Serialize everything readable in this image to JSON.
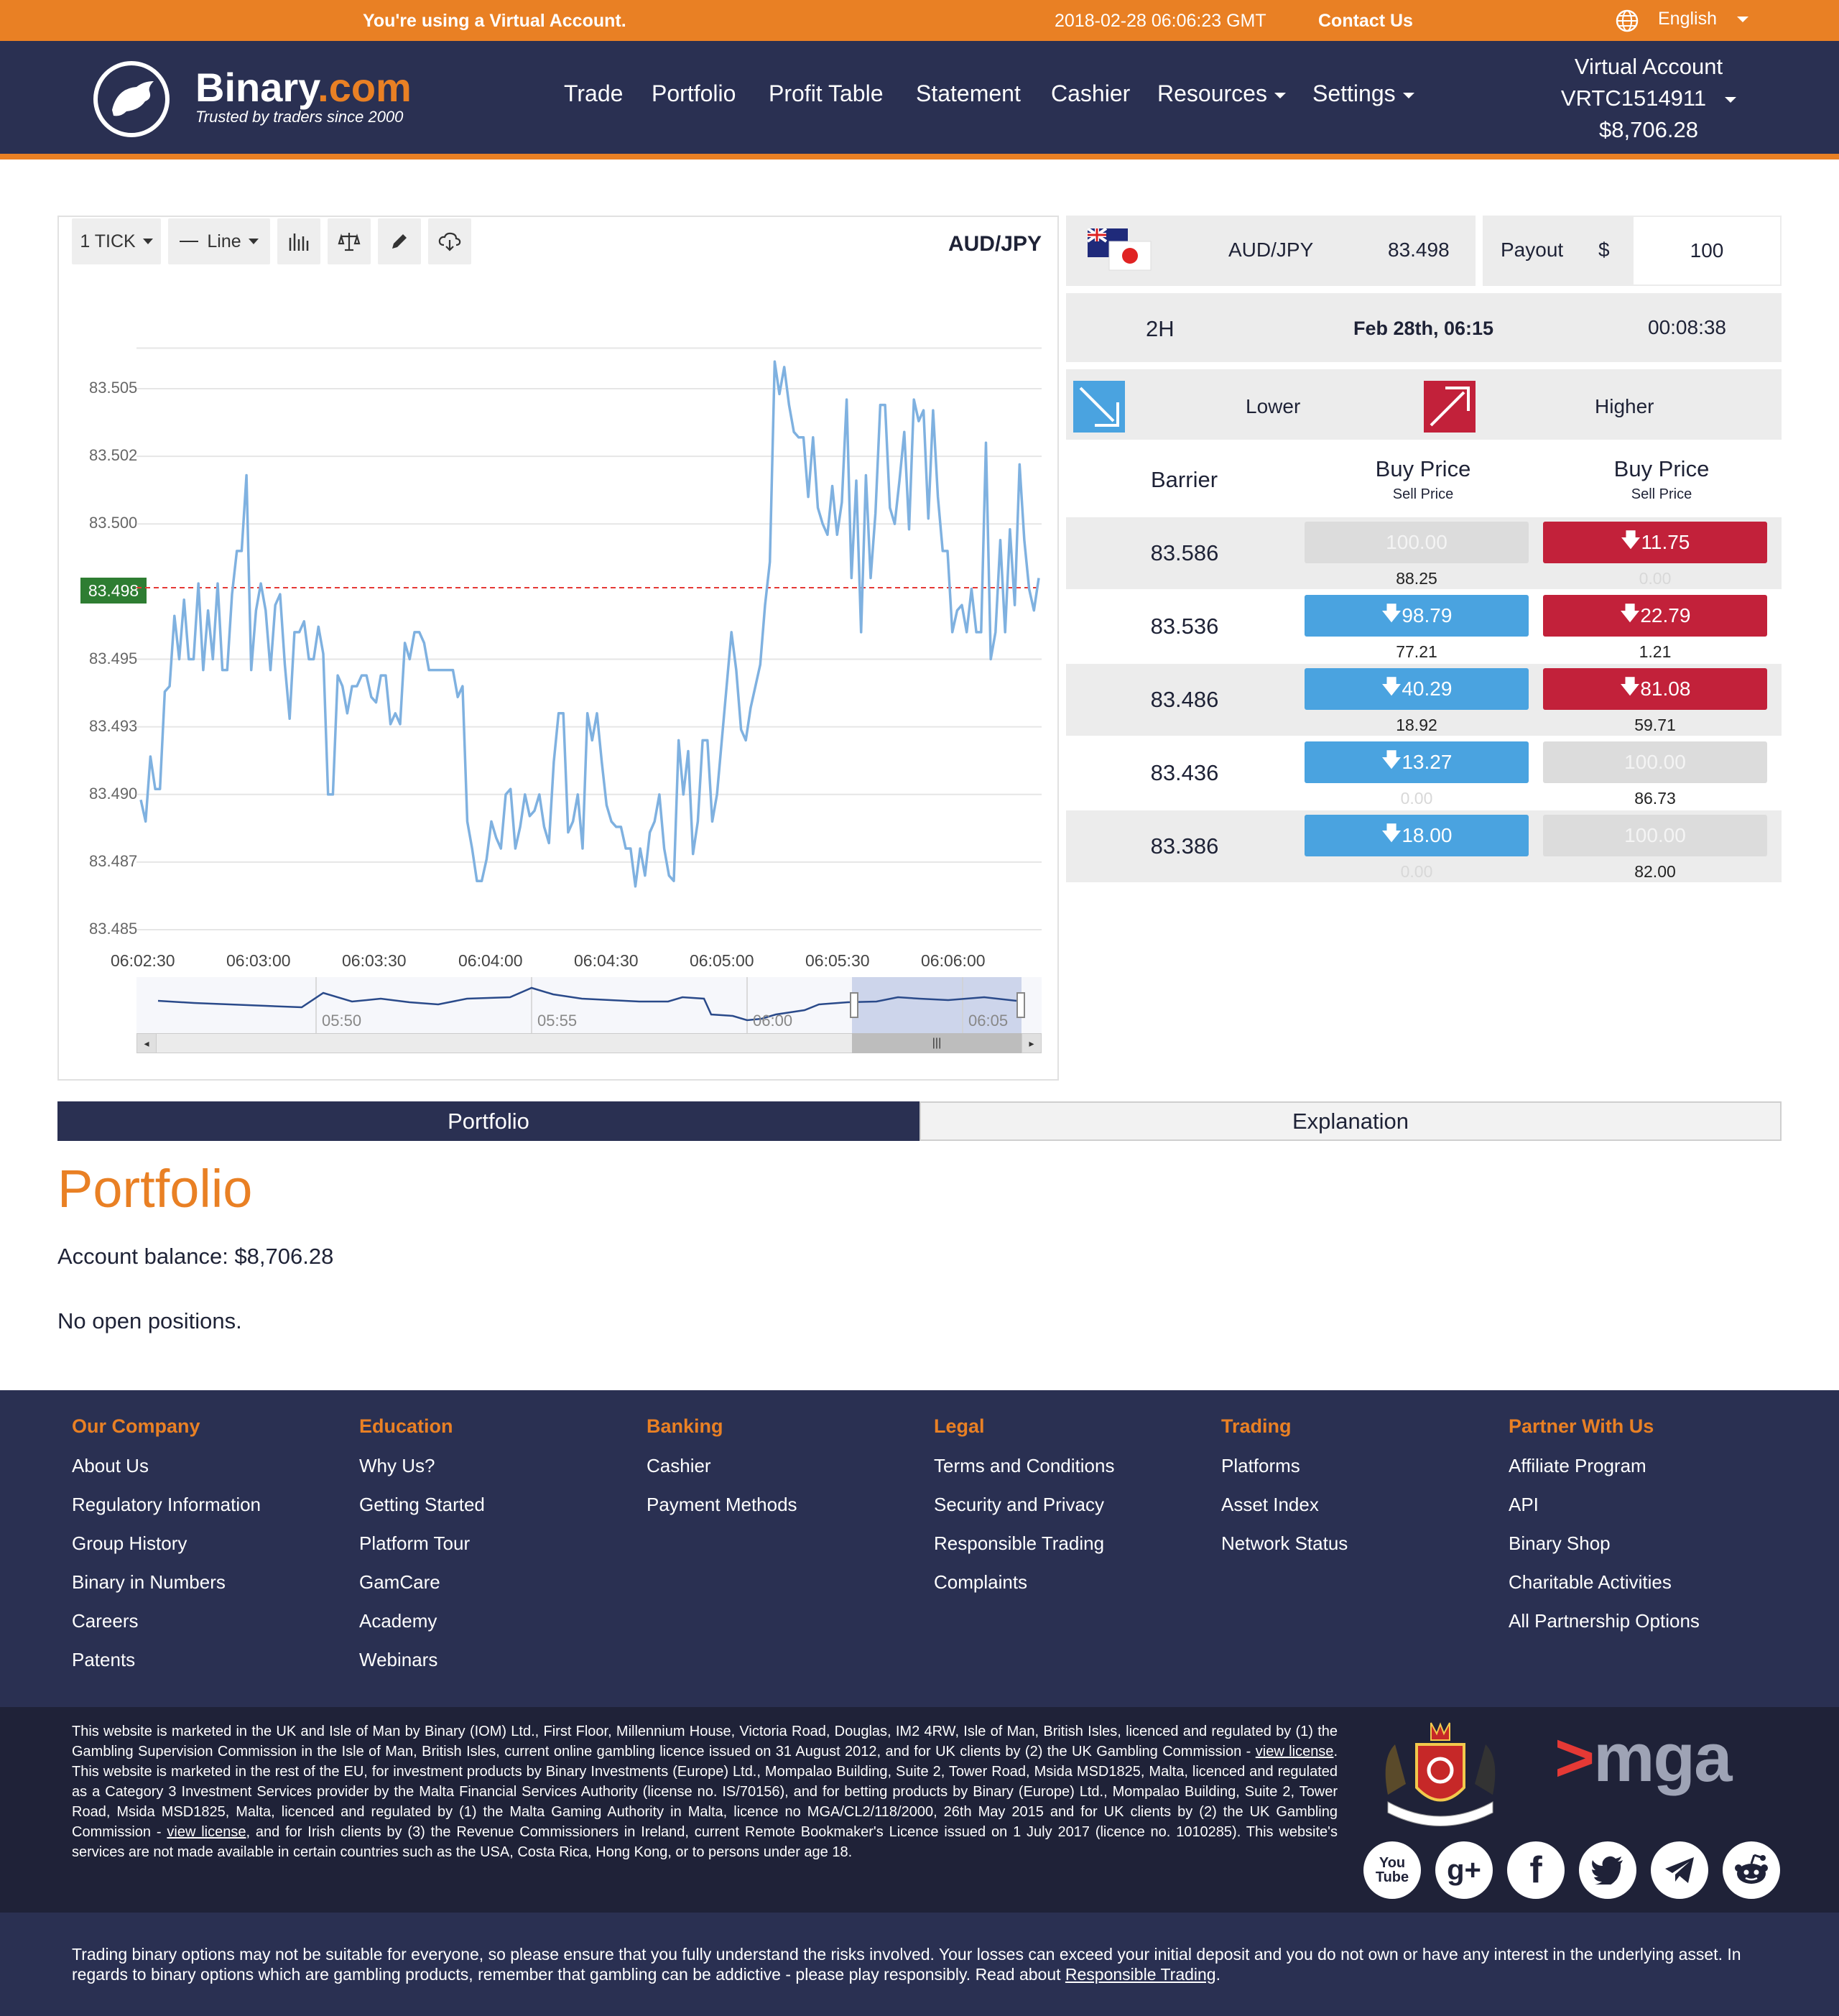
{
  "topbar": {
    "virtual_notice": "You're using a Virtual Account.",
    "timestamp": "2018-02-28 06:06:23 GMT",
    "contact": "Contact Us",
    "language": "English"
  },
  "header": {
    "brand_main": "Binary",
    "brand_tld": ".com",
    "tagline": "Trusted by traders since 2000",
    "nav": [
      "Trade",
      "Portfolio",
      "Profit Table",
      "Statement",
      "Cashier",
      "Resources",
      "Settings"
    ],
    "account_type": "Virtual Account",
    "account_id": "VRTC1514911",
    "balance": "$8,706.28"
  },
  "chart": {
    "interval": "1 TICK",
    "chart_type": "Line",
    "symbol": "AUD/JPY",
    "current_price_label": "83.498",
    "nav_labels": [
      "05:50",
      "05:55",
      "06:00",
      "06:05"
    ]
  },
  "chart_data": {
    "type": "line",
    "title": "AUD/JPY",
    "xlabel": "",
    "ylabel": "",
    "x_ticks": [
      "06:02:30",
      "06:03:00",
      "06:03:30",
      "06:04:00",
      "06:04:30",
      "06:05:00",
      "06:05:30",
      "06:06:00"
    ],
    "y_ticks": [
      "83.485",
      "83.487",
      "83.490",
      "83.493",
      "83.495",
      "83.498",
      "83.500",
      "83.502",
      "83.505"
    ],
    "ylim": [
      83.485,
      83.507
    ],
    "current_price": 83.498,
    "series": [
      {
        "values": [
          83.4898,
          83.489,
          83.4914,
          83.4902,
          83.4902,
          83.4938,
          83.494,
          83.4966,
          83.495,
          83.4972,
          83.495,
          83.495,
          83.4978,
          83.4946,
          83.4968,
          83.495,
          83.4978,
          83.4946,
          83.4946,
          83.4974,
          83.499,
          83.499,
          83.5018,
          83.4946,
          83.4968,
          83.4978,
          83.4968,
          83.4946,
          83.497,
          83.4974,
          83.4948,
          83.4928,
          83.496,
          83.496,
          83.4964,
          83.495,
          83.495,
          83.4962,
          83.4952,
          83.49,
          83.49,
          83.4944,
          83.494,
          83.493,
          83.494,
          83.494,
          83.4944,
          83.4944,
          83.4936,
          83.4934,
          83.4944,
          83.4944,
          83.4926,
          83.493,
          83.4926,
          83.4956,
          83.495,
          83.496,
          83.496,
          83.4956,
          83.4946,
          83.4946,
          83.4946,
          83.4946,
          83.4946,
          83.4946,
          83.4936,
          83.494,
          83.489,
          83.488,
          83.4868,
          83.4868,
          83.4876,
          83.489,
          83.4884,
          83.488,
          83.49,
          83.4902,
          83.488,
          83.4888,
          83.49,
          83.4892,
          83.4894,
          83.49,
          83.4888,
          83.4882,
          83.4912,
          83.493,
          83.493,
          83.4886,
          83.489,
          83.49,
          83.488,
          83.493,
          83.492,
          83.493,
          83.4912,
          83.4896,
          83.489,
          83.4888,
          83.4888,
          83.488,
          83.488,
          83.4866,
          83.488,
          83.487,
          83.4886,
          83.489,
          83.49,
          83.488,
          83.487,
          83.4868,
          83.492,
          83.49,
          83.4916,
          83.4878,
          83.489,
          83.492,
          83.492,
          83.489,
          83.49,
          83.492,
          83.494,
          83.496,
          83.4946,
          83.4924,
          83.492,
          83.4932,
          83.494,
          83.4948,
          83.497,
          83.4986,
          83.506,
          83.5048,
          83.5058,
          83.5044,
          83.5034,
          83.5032,
          83.5032,
          83.501,
          83.5032,
          83.5006,
          83.5,
          83.4996,
          83.5014,
          83.4996,
          83.5008,
          83.5046,
          83.498,
          83.5016,
          83.496,
          83.5018,
          83.498,
          83.5004,
          83.5044,
          83.5044,
          83.5006,
          83.5,
          83.5016,
          83.5034,
          83.4998,
          83.5046,
          83.5038,
          83.5042,
          83.5002,
          83.5042,
          83.501,
          83.499,
          83.499,
          83.496,
          83.4968,
          83.497,
          83.496,
          83.4976,
          83.496,
          83.496,
          83.503,
          83.495,
          83.496,
          83.4994,
          83.496,
          83.4998,
          83.497,
          83.5022,
          83.4994,
          83.4976,
          83.4968,
          83.498
        ]
      }
    ]
  },
  "trade": {
    "symbol": "AUD/JPY",
    "spot": "83.498",
    "payout_label": "Payout",
    "currency": "$",
    "payout_value": "100",
    "duration": "2H",
    "expiry": "Feb 28th, 06:15",
    "countdown": "00:08:38",
    "lower_label": "Lower",
    "higher_label": "Higher",
    "barrier_header": "Barrier",
    "buy_price": "Buy Price",
    "sell_price": "Sell Price",
    "rows": [
      {
        "barrier": "83.586",
        "lower_buy": "100.00",
        "lower_sell": "88.25",
        "higher_buy": "11.75",
        "higher_sell": "0.00"
      },
      {
        "barrier": "83.536",
        "lower_buy": "98.79",
        "lower_sell": "77.21",
        "higher_buy": "22.79",
        "higher_sell": "1.21"
      },
      {
        "barrier": "83.486",
        "lower_buy": "40.29",
        "lower_sell": "18.92",
        "higher_buy": "81.08",
        "higher_sell": "59.71"
      },
      {
        "barrier": "83.436",
        "lower_buy": "13.27",
        "lower_sell": "0.00",
        "higher_buy": "100.00",
        "higher_sell": "86.73"
      },
      {
        "barrier": "83.386",
        "lower_buy": "18.00",
        "lower_sell": "0.00",
        "higher_buy": "100.00",
        "higher_sell": "82.00"
      }
    ]
  },
  "tabs": {
    "portfolio": "Portfolio",
    "explanation": "Explanation"
  },
  "portfolio": {
    "title": "Portfolio",
    "balance_text": "Account balance: $8,706.28",
    "empty_text": "No open positions."
  },
  "footer": {
    "columns": [
      {
        "title": "Our Company",
        "links": [
          "About Us",
          "Regulatory Information",
          "Group History",
          "Binary in Numbers",
          "Careers",
          "Patents"
        ]
      },
      {
        "title": "Education",
        "links": [
          "Why Us?",
          "Getting Started",
          "Platform Tour",
          "GamCare",
          "Academy",
          "Webinars"
        ]
      },
      {
        "title": "Banking",
        "links": [
          "Cashier",
          "Payment Methods"
        ]
      },
      {
        "title": "Legal",
        "links": [
          "Terms and Conditions",
          "Security and Privacy",
          "Responsible Trading",
          "Complaints"
        ]
      },
      {
        "title": "Trading",
        "links": [
          "Platforms",
          "Asset Index",
          "Network Status"
        ]
      },
      {
        "title": "Partner With Us",
        "links": [
          "Affiliate Program",
          "API",
          "Binary Shop",
          "Charitable Activities",
          "All Partnership Options"
        ]
      }
    ],
    "legal_1": "This website is marketed in the UK and Isle of Man by Binary (IOM) Ltd., First Floor, Millennium House, Victoria Road, Douglas, IM2 4RW, Isle of Man, British Isles, licenced and regulated by (1) the Gambling Supervision Commission in the Isle of Man, British Isles, current online gambling licence issued on 31 August 2012, and for UK clients by (2) the UK Gambling Commission - ",
    "view_license": "view license",
    "legal_2": ". This website is marketed in the rest of the EU, for investment products by Binary Investments (Europe) Ltd., Mompalao Building, Suite 2, Tower Road, Msida MSD1825, Malta, licenced and regulated as a Category 3 Investment Services provider by the Malta Financial Services Authority (license no. IS/70156), and for betting products by Binary (Europe) Ltd., Mompalao Building, Suite 2, Tower Road, Msida MSD1825, Malta, licenced and regulated by (1) the Malta Gaming Authority in Malta, licence no MGA/CL2/118/2000, 26th May 2015 and for UK clients by (2) the UK Gambling Commission - ",
    "legal_3": ", and for Irish clients by (3) the Revenue Commissioners in Ireland, current Remote Bookmaker's Licence issued on 1 July 2017 (licence no. 1010285). This website's services are not made available in certain countries such as the USA, Costa Rica, Hong Kong, or to persons under age 18.",
    "mga_logo": "mga",
    "risk_text": "Trading binary options may not be suitable for everyone, so please ensure that you fully understand the risks involved. Your losses can exceed your initial deposit and you do not own or have any interest in the underlying asset. In regards to binary options which are gambling products, remember that gambling can be addictive - please play responsibly. Read about ",
    "risk_link": "Responsible Trading",
    "risk_end": "."
  },
  "colors": {
    "orange": "#e98024",
    "navy": "#2a3052",
    "blue": "#4aa3e0",
    "red": "#c2213a",
    "green": "#2e7d32"
  },
  "icons": [
    "globe-icon",
    "bull-logo-icon",
    "candles-icon",
    "scale-icon",
    "pencil-icon",
    "cloud-download-icon",
    "arrow-down-icon",
    "arrow-down-right-icon",
    "arrow-up-right-icon",
    "youtube-icon",
    "google-plus-icon",
    "facebook-icon",
    "twitter-icon",
    "telegram-icon",
    "reddit-icon"
  ]
}
